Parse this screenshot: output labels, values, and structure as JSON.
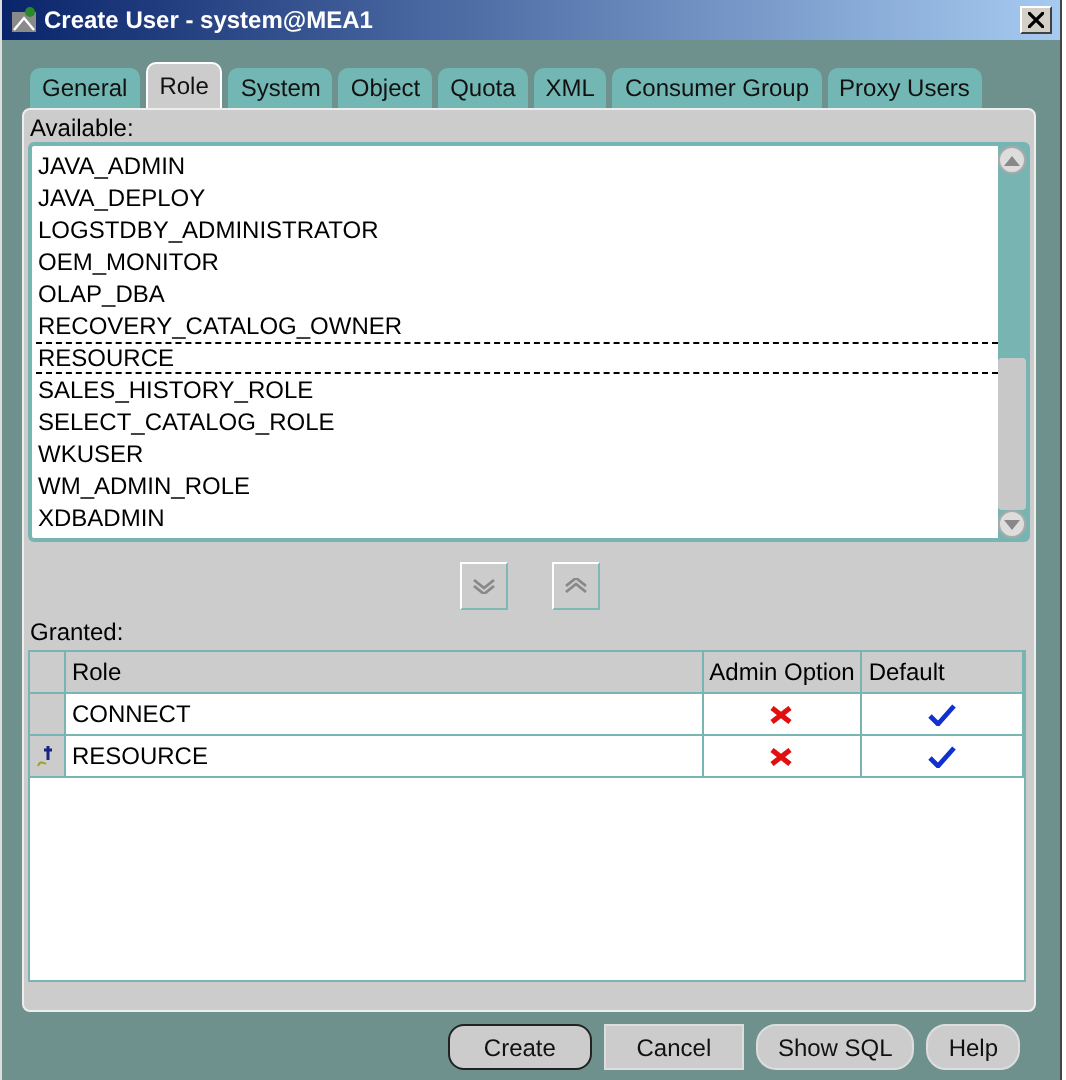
{
  "window": {
    "title": "Create User - system@MEA1"
  },
  "tabs": [
    {
      "label": "General",
      "selected": false
    },
    {
      "label": "Role",
      "selected": true
    },
    {
      "label": "System",
      "selected": false
    },
    {
      "label": "Object",
      "selected": false
    },
    {
      "label": "Quota",
      "selected": false
    },
    {
      "label": "XML",
      "selected": false
    },
    {
      "label": "Consumer Group",
      "selected": false
    },
    {
      "label": "Proxy Users",
      "selected": false
    }
  ],
  "available": {
    "label": "Available:",
    "items": [
      {
        "label": "JAVA_ADMIN",
        "selected": false
      },
      {
        "label": "JAVA_DEPLOY",
        "selected": false
      },
      {
        "label": "LOGSTDBY_ADMINISTRATOR",
        "selected": false
      },
      {
        "label": "OEM_MONITOR",
        "selected": false
      },
      {
        "label": "OLAP_DBA",
        "selected": false
      },
      {
        "label": "RECOVERY_CATALOG_OWNER",
        "selected": false
      },
      {
        "label": "RESOURCE",
        "selected": true
      },
      {
        "label": "SALES_HISTORY_ROLE",
        "selected": false
      },
      {
        "label": "SELECT_CATALOG_ROLE",
        "selected": false
      },
      {
        "label": "WKUSER",
        "selected": false
      },
      {
        "label": "WM_ADMIN_ROLE",
        "selected": false
      },
      {
        "label": "XDBADMIN",
        "selected": false
      }
    ]
  },
  "granted": {
    "label": "Granted:",
    "columns": [
      "Role",
      "Admin Option",
      "Default"
    ],
    "rows": [
      {
        "role": "CONNECT",
        "admin_option": false,
        "default": true,
        "current": false
      },
      {
        "role": "RESOURCE",
        "admin_option": false,
        "default": true,
        "current": true
      }
    ]
  },
  "buttons": [
    {
      "label": "Create",
      "kind": "default"
    },
    {
      "label": "Cancel",
      "kind": "flat"
    },
    {
      "label": "Show SQL",
      "kind": "round"
    },
    {
      "label": "Help",
      "kind": "round"
    }
  ]
}
